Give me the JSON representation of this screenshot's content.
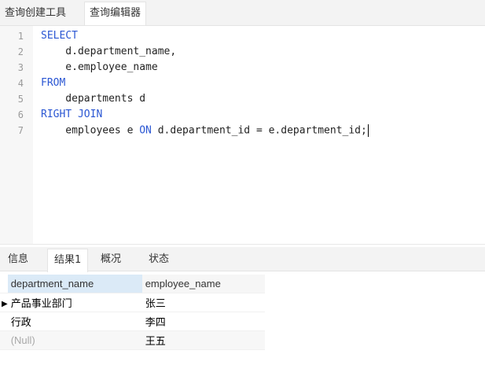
{
  "top_tabs": [
    "查询创建工具",
    "查询编辑器"
  ],
  "editor": {
    "line_numbers": [
      "1",
      "2",
      "3",
      "4",
      "5",
      "6",
      "7"
    ],
    "lines": [
      {
        "kw": "SELECT",
        "text": ""
      },
      {
        "kw": "",
        "text": "    d.department_name,"
      },
      {
        "kw": "",
        "text": "    e.employee_name"
      },
      {
        "kw": "FROM",
        "text": ""
      },
      {
        "kw": "",
        "text": "    departments d"
      },
      {
        "kw": "RIGHT JOIN",
        "text": ""
      },
      {
        "kw": "",
        "text": "    employees e ",
        "kw2": "ON",
        "text2": " d.department_id = e.department_id;"
      }
    ]
  },
  "bottom_tabs": [
    "信息",
    "结果1",
    "概况",
    "状态"
  ],
  "results": {
    "columns": [
      "department_name",
      "employee_name"
    ],
    "rows": [
      [
        "产品事业部门",
        "张三"
      ],
      [
        "行政",
        "李四"
      ],
      [
        "(Null)",
        "王五"
      ]
    ],
    "current_row_marker": "▶"
  },
  "colors": {
    "keyword": "#2b57d3",
    "header_selected": "#dbeaf7",
    "null_text": "#a8a8a8"
  }
}
